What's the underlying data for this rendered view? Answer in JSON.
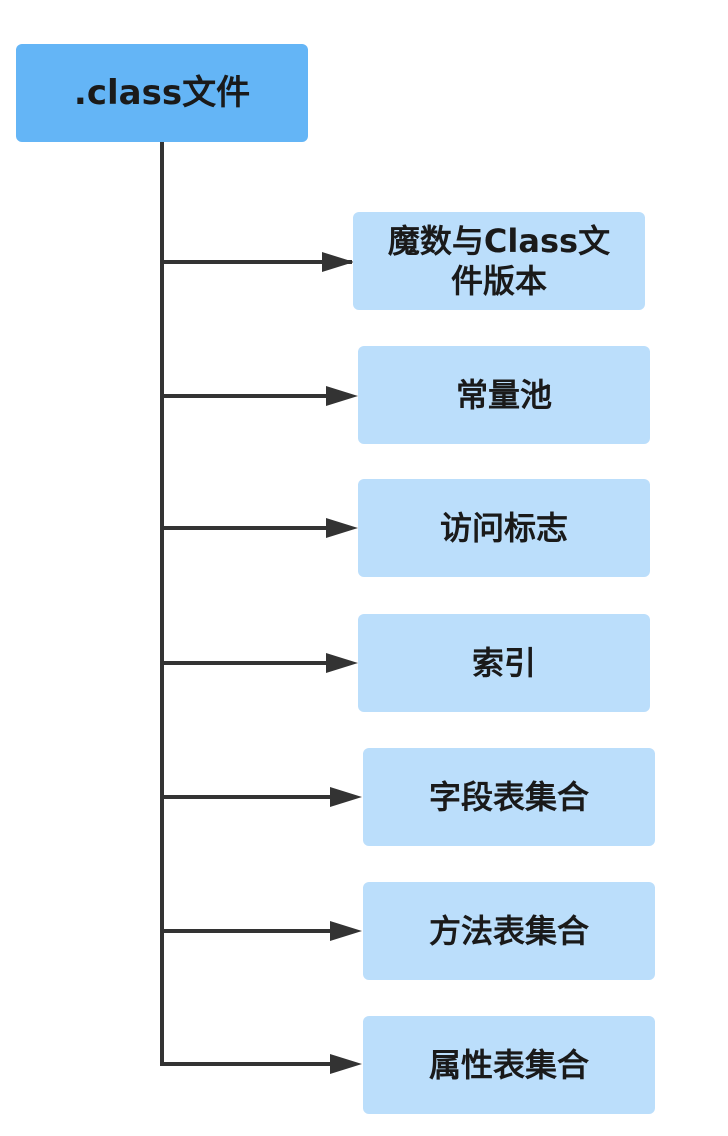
{
  "root": {
    "label": ".class文件"
  },
  "children": [
    {
      "label": "魔数与Class文件版本"
    },
    {
      "label": "常量池"
    },
    {
      "label": "访问标志"
    },
    {
      "label": "索引"
    },
    {
      "label": "字段表集合"
    },
    {
      "label": "方法表集合"
    },
    {
      "label": "属性表集合"
    }
  ],
  "colors": {
    "root_fill": "#64b5f6",
    "child_fill": "#bbdefb",
    "connector": "#333333",
    "text": "#1a1a1a"
  }
}
